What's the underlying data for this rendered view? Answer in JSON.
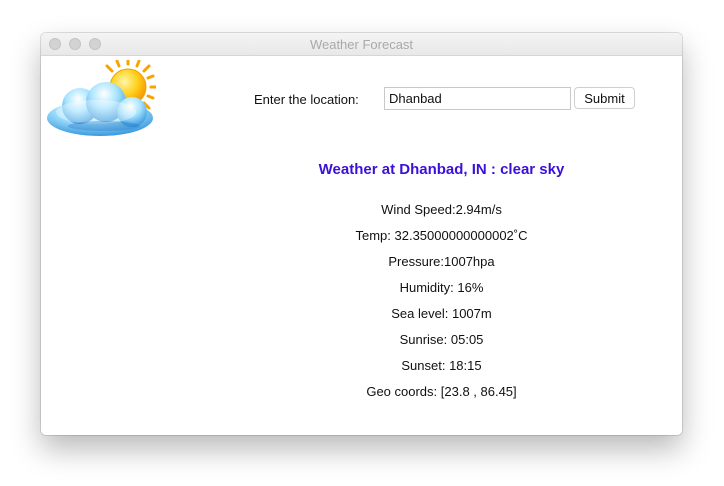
{
  "window": {
    "title": "Weather Forecast"
  },
  "logo": {
    "icon": "sun-behind-cloud-icon"
  },
  "form": {
    "label": "Enter the location:",
    "location_value": "Dhanbad",
    "submit_label": "Submit"
  },
  "result": {
    "headline": "Weather at Dhanbad, IN : clear sky",
    "headline_color": "#3b10d9",
    "details": {
      "wind_speed": "Wind Speed:2.94m/s",
      "temp": "Temp: 32.35000000000002˚C",
      "pressure": "Pressure:1007hpa",
      "humidity": "Humidity: 16%",
      "sea_level": "Sea level: 1007m",
      "sunrise": "Sunrise: 05:05",
      "sunset": "Sunset: 18:15",
      "geo_coords": "Geo coords: [23.8 , 86.45]"
    }
  }
}
